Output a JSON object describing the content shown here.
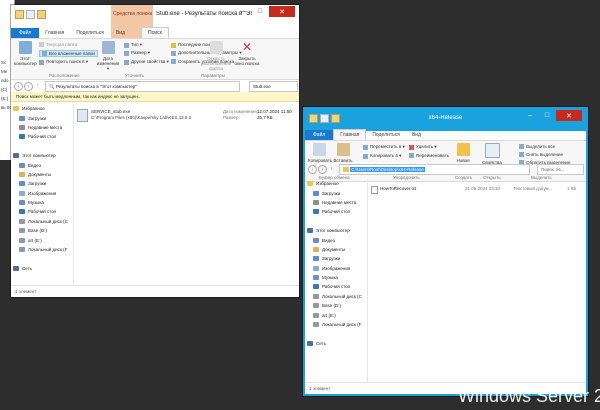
{
  "background": {
    "color": "#2d2d2d",
    "watermark": "Windows Server 2",
    "left_stub_labels": [
      "Sc",
      "Ме",
      "ndo",
      "(C)",
      "(E:)",
      "вь 80"
    ]
  },
  "win1": {
    "title": "Stub.exe - Результаты поиска в \"Этот ко...",
    "context_tab_title": "Средства поиска",
    "tabs": [
      "Файл",
      "Главная",
      "Поделиться",
      "Вид",
      "Поиск"
    ],
    "ribbon": {
      "this_pc": "Этот компьютер",
      "current_folder": "Текущая папка",
      "all_subfolders": "Все вложенные папки",
      "search_again": "Повторить поиск в ▾",
      "date_modified": "Дата изменения ▾",
      "type": "Тип ▾",
      "size": "Размер ▾",
      "other_props": "Другие свойства ▾",
      "recent_searches": "Последние поиски ▾",
      "advanced": "Дополнительные параметры ▾",
      "save_search": "Сохранить условия поиска",
      "open_location": "Открыть расположение файла",
      "close_search": "Закрыть окно поиска",
      "group_location": "Расположение",
      "group_refine": "Уточнить",
      "group_options": "Параметры"
    },
    "address": "Результаты поиска в \"Этот компьютер\"",
    "search_value": "Stub.exe",
    "info_bar": "Поиск может быть медленным, так как индекс не запущен...",
    "nav_items": [
      {
        "label": "Избранное",
        "color": "#f2c14e",
        "indent": 0
      },
      {
        "label": "Загрузки",
        "color": "#5b8fcf",
        "indent": 1
      },
      {
        "label": "Недавние места",
        "color": "#8e8e8e",
        "indent": 1
      },
      {
        "label": "Рабочий стол",
        "color": "#3a77b8",
        "indent": 1
      },
      {
        "label": "",
        "color": "",
        "indent": 0
      },
      {
        "label": "Этот компьютер",
        "color": "#4a6fa5",
        "indent": 0
      },
      {
        "label": "Видео",
        "color": "#6a8fbf",
        "indent": 1
      },
      {
        "label": "Документы",
        "color": "#d9b45a",
        "indent": 1
      },
      {
        "label": "Загрузки",
        "color": "#5b8fcf",
        "indent": 1
      },
      {
        "label": "Изображения",
        "color": "#7faed6",
        "indent": 1
      },
      {
        "label": "Музыка",
        "color": "#6a8fbf",
        "indent": 1
      },
      {
        "label": "Рабочий стол",
        "color": "#3a77b8",
        "indent": 1
      },
      {
        "label": "Локальный диск (C",
        "color": "#8a9aaa",
        "indent": 1
      },
      {
        "label": "Base (D:)",
        "color": "#8a9aaa",
        "indent": 1
      },
      {
        "label": "art (E:)",
        "color": "#8a9aaa",
        "indent": 1
      },
      {
        "label": "Локальный диск (F",
        "color": "#8a9aaa",
        "indent": 1
      },
      {
        "label": "",
        "color": "",
        "indent": 0
      },
      {
        "label": "Сеть",
        "color": "#4a6fa5",
        "indent": 0
      }
    ],
    "result": {
      "name": "SERVICE_stub.exe",
      "path": "C:\\Program Files (x86)\\Kaspersky Lab\\KES.12.8.0",
      "date_label": "Дата изменения:",
      "date_value": "12.07.2024 11:50",
      "size_label": "Размер:",
      "size_value": "35,7 КБ"
    },
    "status": "1 элемент"
  },
  "win2": {
    "title": "x64-Release",
    "tabs": [
      "Файл",
      "Главная",
      "Поделиться",
      "Вид"
    ],
    "ribbon": {
      "copy": "Копировать",
      "paste": "Вставить",
      "move_to": "Переместить в ▾",
      "copy_to": "Копировать в ▾",
      "delete": "Удалить ▾",
      "rename": "Переименовать",
      "new_folder": "Новая папка",
      "properties": "Свойства",
      "select_all": "Выделить все",
      "select_none": "Снять выделение",
      "invert": "Обратить выделение",
      "group_clipboard": "Буфер обмена",
      "group_organize": "Упорядочить",
      "group_new": "Создать",
      "group_open": "Открыть",
      "group_select": "Выделить"
    },
    "address": "C:\\Users\\Root\\Desktop\\x64-Release",
    "search_placeholder": "Поиск: x6...",
    "nav_items": [
      {
        "label": "Избранное",
        "color": "#f2c14e",
        "indent": 0
      },
      {
        "label": "Загрузки",
        "color": "#5b8fcf",
        "indent": 1
      },
      {
        "label": "Недавние места",
        "color": "#8e8e8e",
        "indent": 1
      },
      {
        "label": "Рабочий стол",
        "color": "#3a77b8",
        "indent": 1
      },
      {
        "label": "",
        "color": "",
        "indent": 0
      },
      {
        "label": "Этот компьютер",
        "color": "#4a6fa5",
        "indent": 0
      },
      {
        "label": "Видео",
        "color": "#6a8fbf",
        "indent": 1
      },
      {
        "label": "Документы",
        "color": "#d9b45a",
        "indent": 1
      },
      {
        "label": "Загрузки",
        "color": "#5b8fcf",
        "indent": 1
      },
      {
        "label": "Изображения",
        "color": "#7faed6",
        "indent": 1
      },
      {
        "label": "Музыка",
        "color": "#6a8fbf",
        "indent": 1
      },
      {
        "label": "Рабочий стол",
        "color": "#3a77b8",
        "indent": 1
      },
      {
        "label": "Локальный диск (C",
        "color": "#8a9aaa",
        "indent": 1
      },
      {
        "label": "Base (D:)",
        "color": "#8a9aaa",
        "indent": 1
      },
      {
        "label": "art (E:)",
        "color": "#8a9aaa",
        "indent": 1
      },
      {
        "label": "Локальный диск (F",
        "color": "#8a9aaa",
        "indent": 1
      },
      {
        "label": "",
        "color": "",
        "indent": 0
      },
      {
        "label": "Сеть",
        "color": "#4a6fa5",
        "indent": 0
      }
    ],
    "file": {
      "name": "HowToRecover.txt",
      "date": "21.05.2024 23:10",
      "type": "Текстовый докум...",
      "size": "1 КБ"
    },
    "status": "1 элемент"
  }
}
